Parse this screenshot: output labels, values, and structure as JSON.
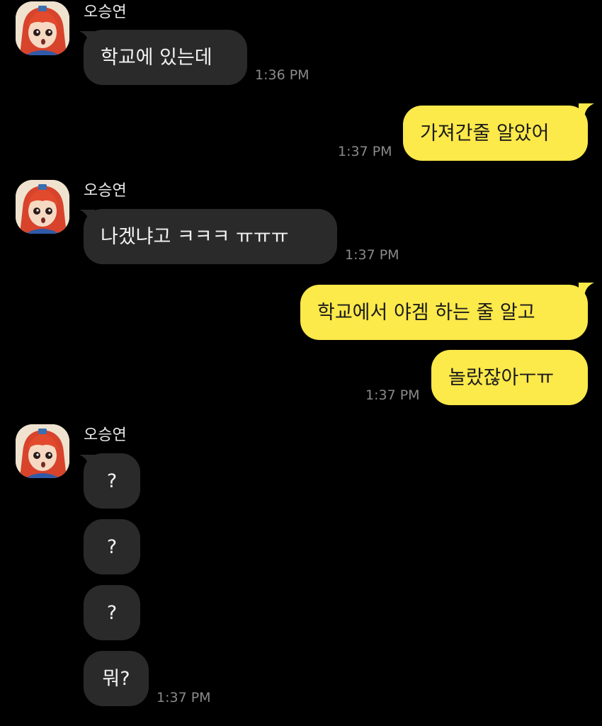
{
  "chat": {
    "messages": [
      {
        "sender": "오승연",
        "text": "학교에 있는데",
        "time": "1:36 PM"
      },
      {
        "text": "가져간줄 알았어",
        "time": "1:37 PM"
      },
      {
        "sender": "오승연",
        "text": "나겠냐고 ㅋㅋㅋ ㅠㅠㅠ",
        "time": "1:37 PM"
      },
      {
        "text": "학교에서 야겜 하는 줄 알고"
      },
      {
        "text": "놀랐잖아ㅜㅠ",
        "time": "1:37 PM"
      },
      {
        "sender": "오승연",
        "text": "?"
      },
      {
        "text": "?"
      },
      {
        "text": "?"
      },
      {
        "text": "뭐?",
        "time": "1:37 PM"
      }
    ]
  },
  "colors": {
    "background": "#000000",
    "incoming_bubble": "#2a2a2a",
    "outgoing_bubble": "#fce94a",
    "timestamp": "#8a8a8a"
  },
  "icons": {
    "avatar": "profile-avatar-red-haired-anime-character"
  }
}
